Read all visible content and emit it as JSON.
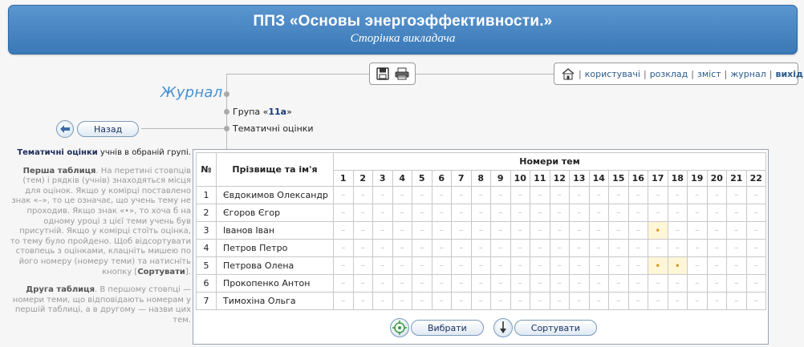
{
  "header": {
    "title": "ППЗ «Основы энергоэффективности.»",
    "subtitle": "Сторінка викладача"
  },
  "nav": {
    "users": "користувачі",
    "schedule": "розклад",
    "contents": "зміст",
    "journal": "журнал",
    "exit": "вихід",
    "separator": "|"
  },
  "page": {
    "section_title": "Журнал",
    "group_prefix": "Група «",
    "group_name": "11а",
    "group_suffix": "»",
    "topic_label": "Тематичні оцінки",
    "back_label": "Назад"
  },
  "help": {
    "intro_bold": "Тематичні оцінки",
    "intro_rest": " учнів в обраній групі.",
    "first_bold": "Перша таблиця",
    "first_text": ". На перетині стовпців (тем) і рядків (учнів) знаходяться місця для оцінок. Якщо у комірці поставлено знак «–», то це означає, що учень тему не проходив. Якщо знак «•», то хоча б на одному уроці з цієї теми учень був присутній. Якщо у комірці стоїть оцінка, то тему було пройдено. Щоб відсортувати стовпець з оцінками, клацніть мишею по його номеру (номеру теми) та натисніть кнопку [",
    "first_button": "Сортувати",
    "first_end": "].",
    "second_bold": "Друга таблиця",
    "second_text": ". В першому стовпці — номери теми, що відповідають номерам у першій таблиці, а в другому — назви цих тем."
  },
  "table": {
    "col_num": "№",
    "col_name": "Прізвище та ім'я",
    "col_topics": "Номери тем",
    "topics": [
      "1",
      "2",
      "3",
      "4",
      "5",
      "6",
      "7",
      "8",
      "9",
      "10",
      "11",
      "12",
      "13",
      "14",
      "15",
      "16",
      "17",
      "18",
      "19",
      "20",
      "21",
      "22"
    ],
    "rows": [
      {
        "num": "1",
        "name": "Євдокимов Олександр",
        "marks": [
          "–",
          "–",
          "–",
          "–",
          "–",
          "–",
          "–",
          "–",
          "–",
          "–",
          "–",
          "–",
          "–",
          "–",
          "–",
          "–",
          "–",
          "–",
          "–",
          "–",
          "–",
          "–"
        ]
      },
      {
        "num": "2",
        "name": "Єгоров Єгор",
        "marks": [
          "–",
          "–",
          "–",
          "–",
          "–",
          "–",
          "–",
          "–",
          "–",
          "–",
          "–",
          "–",
          "–",
          "–",
          "–",
          "–",
          "–",
          "–",
          "–",
          "–",
          "–",
          "–"
        ]
      },
      {
        "num": "3",
        "name": "Іванов Іван",
        "marks": [
          "–",
          "–",
          "–",
          "–",
          "–",
          "–",
          "–",
          "–",
          "–",
          "–",
          "–",
          "–",
          "–",
          "–",
          "–",
          "–",
          "•",
          "–",
          "–",
          "–",
          "–",
          "–"
        ]
      },
      {
        "num": "4",
        "name": "Петров Петро",
        "marks": [
          "–",
          "–",
          "–",
          "–",
          "–",
          "–",
          "–",
          "–",
          "–",
          "–",
          "–",
          "–",
          "–",
          "–",
          "–",
          "–",
          "–",
          "–",
          "–",
          "–",
          "–",
          "–"
        ]
      },
      {
        "num": "5",
        "name": "Петрова Олена",
        "marks": [
          "–",
          "–",
          "–",
          "–",
          "–",
          "–",
          "–",
          "–",
          "–",
          "–",
          "–",
          "–",
          "–",
          "–",
          "–",
          "–",
          "•",
          "•",
          "–",
          "–",
          "–",
          "–"
        ]
      },
      {
        "num": "6",
        "name": "Прокопенко Антон",
        "marks": [
          "–",
          "–",
          "–",
          "–",
          "–",
          "–",
          "–",
          "–",
          "–",
          "–",
          "–",
          "–",
          "–",
          "–",
          "–",
          "–",
          "–",
          "–",
          "–",
          "–",
          "–",
          "–"
        ]
      },
      {
        "num": "7",
        "name": "Тимохіна Ольга",
        "marks": [
          "–",
          "–",
          "–",
          "–",
          "–",
          "–",
          "–",
          "–",
          "–",
          "–",
          "–",
          "–",
          "–",
          "–",
          "–",
          "–",
          "–",
          "–",
          "–",
          "–",
          "–",
          "–"
        ]
      }
    ]
  },
  "buttons": {
    "select": "Вибрати",
    "sort": "Сортувати"
  },
  "icons": {
    "home": "home-icon",
    "save": "floppy-icon",
    "print": "printer-icon",
    "back": "back-arrow-icon",
    "select": "target-icon",
    "sort": "down-arrow-icon"
  }
}
